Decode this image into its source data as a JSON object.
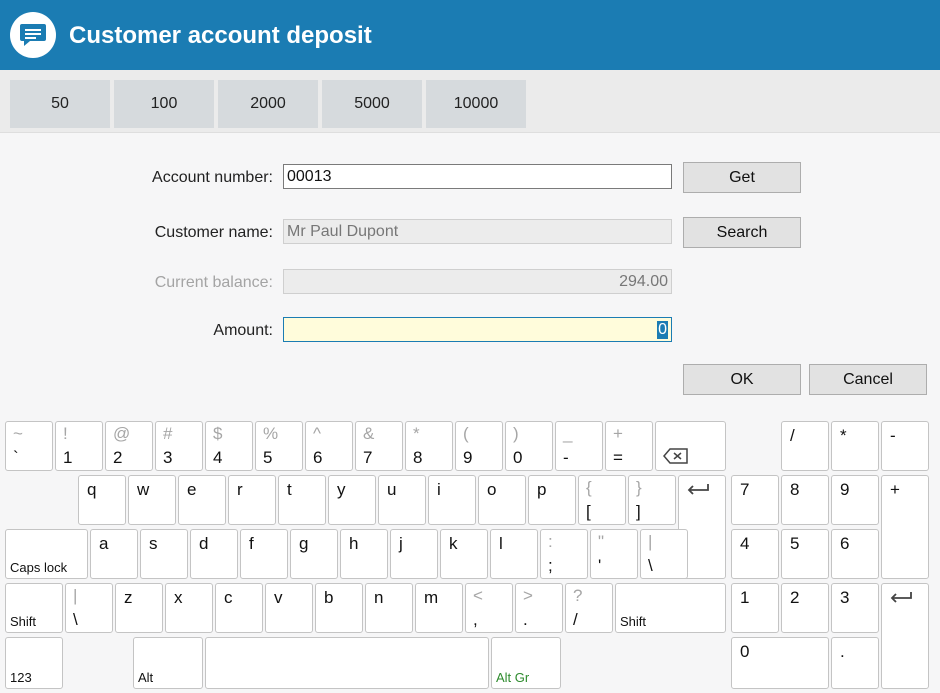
{
  "window": {
    "title": "Customer account deposit",
    "icon": "chat-bubble-icon"
  },
  "presets": [
    "50",
    "100",
    "2000",
    "5000",
    "10000"
  ],
  "form": {
    "account_number": {
      "label": "Account number:",
      "value": "00013"
    },
    "customer_name": {
      "label": "Customer name:",
      "value": "Mr Paul Dupont"
    },
    "current_balance": {
      "label": "Current balance:",
      "value": "294.00"
    },
    "amount": {
      "label": "Amount:",
      "value": "0"
    }
  },
  "buttons": {
    "get": "Get",
    "search": "Search",
    "ok": "OK",
    "cancel": "Cancel"
  },
  "keyboard": {
    "numbers": [
      {
        "top": "~",
        "bot": "`"
      },
      {
        "top": "!",
        "bot": "1"
      },
      {
        "top": "@",
        "bot": "2"
      },
      {
        "top": "#",
        "bot": "3"
      },
      {
        "top": "$",
        "bot": "4"
      },
      {
        "top": "%",
        "bot": "5"
      },
      {
        "top": "^",
        "bot": "6"
      },
      {
        "top": "&",
        "bot": "7"
      },
      {
        "top": "*",
        "bot": "8"
      },
      {
        "top": "(",
        "bot": "9"
      },
      {
        "top": ")",
        "bot": "0"
      },
      {
        "top": "_",
        "bot": "-"
      },
      {
        "top": "+",
        "bot": "="
      }
    ],
    "row_q": [
      "q",
      "w",
      "e",
      "r",
      "t",
      "y",
      "u",
      "i",
      "o",
      "p"
    ],
    "row_q_sym": [
      {
        "top": "{",
        "bot": "["
      },
      {
        "top": "}",
        "bot": "]"
      }
    ],
    "row_a": [
      "a",
      "s",
      "d",
      "f",
      "g",
      "h",
      "j",
      "k",
      "l"
    ],
    "row_a_sym": [
      {
        "top": ":",
        "bot": ";"
      },
      {
        "top": "\"",
        "bot": "'"
      },
      {
        "top": "|",
        "bot": "\\"
      }
    ],
    "row_z_pre": {
      "top": "|",
      "bot": "\\"
    },
    "row_z": [
      "z",
      "x",
      "c",
      "v",
      "b",
      "n",
      "m"
    ],
    "row_z_sym": [
      {
        "top": "<",
        "bot": ","
      },
      {
        "top": ">",
        "bot": "."
      },
      {
        "top": "?",
        "bot": "/"
      }
    ],
    "labels": {
      "caps_lock": "Caps lock",
      "shift": "Shift",
      "mode": "123",
      "alt": "Alt",
      "alt_gr": "Alt Gr"
    },
    "numpad": {
      "ops": [
        "/",
        "*",
        "-"
      ],
      "plus": "+",
      "digits": [
        [
          "7",
          "8",
          "9"
        ],
        [
          "4",
          "5",
          "6"
        ],
        [
          "1",
          "2",
          "3"
        ]
      ],
      "zero": "0",
      "dot": "."
    }
  }
}
